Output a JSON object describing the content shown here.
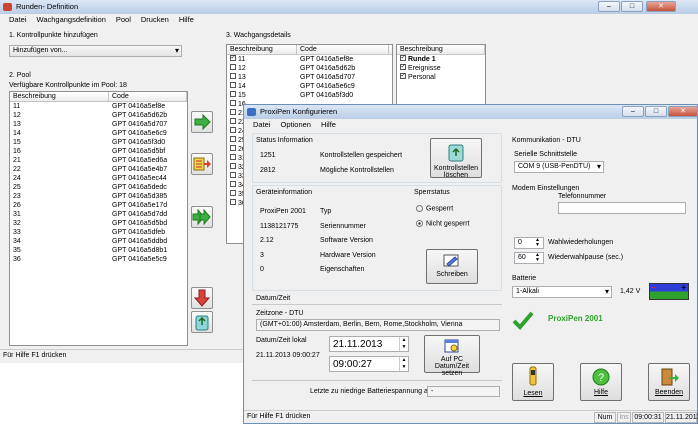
{
  "main": {
    "title": "Runden- Definition",
    "menu": [
      "Datei",
      "Wachgangsdefinition",
      "Pool",
      "Drucken",
      "Hilfe"
    ],
    "step1": "1. Kontrollpunkte hinzufügen",
    "add_dropdown": "Hinzufügen von...",
    "step2": "2. Pool",
    "pool_count": "Verfügbare Kontrollpunkte im Pool: 18",
    "pool_headers": [
      "Beschreibung",
      "Code"
    ],
    "pool_rows": [
      [
        "11",
        "GPT 0416a5ef8e"
      ],
      [
        "12",
        "GPT 0416a5d62b"
      ],
      [
        "13",
        "GPT 0416a5d707"
      ],
      [
        "14",
        "GPT 0416a5e6c9"
      ],
      [
        "15",
        "GPT 0416a5f3d0"
      ],
      [
        "16",
        "GPT 0416a5d5bf"
      ],
      [
        "21",
        "GPT 0416a5ed6a"
      ],
      [
        "22",
        "GPT 0416a5e4b7"
      ],
      [
        "24",
        "GPT 0416a5ec44"
      ],
      [
        "25",
        "GPT 0416a5dedc"
      ],
      [
        "23",
        "GPT 0416a5d385"
      ],
      [
        "26",
        "GPT 0416a5e17d"
      ],
      [
        "31",
        "GPT 0416a5d7dd"
      ],
      [
        "32",
        "GPT 0416a5d5bd"
      ],
      [
        "33",
        "GPT 0416a5dfeb"
      ],
      [
        "34",
        "GPT 0416a5ddbd"
      ],
      [
        "35",
        "GPT 0416a5d8b1"
      ],
      [
        "36",
        "GPT 0416a5e5c9"
      ]
    ],
    "step3": "3. Wachgangsdetails",
    "details_headers": [
      "Beschreibung",
      "Code"
    ],
    "details_rows": [
      [
        "11",
        "GPT 0416a5ef8e"
      ],
      [
        "12",
        "GPT 0416a5d62b"
      ],
      [
        "13",
        "GPT 0416a5d707"
      ],
      [
        "14",
        "GPT 0416a5e6c9"
      ],
      [
        "15",
        "GPT 0416a5f3d0"
      ]
    ],
    "details_more": [
      "16",
      "21",
      "22",
      "24",
      "25",
      "26",
      "31",
      "32",
      "33",
      "34",
      "35",
      "36"
    ],
    "round_header": "Beschreibung",
    "round_items": [
      "Runde 1",
      "Ereignisse",
      "Personal"
    ],
    "status": "Für Hilfe F1 drücken"
  },
  "dialog": {
    "title": "ProxiPen Konfigurieren",
    "menu": [
      "Datei",
      "Optionen",
      "Hilfe"
    ],
    "status_info": "Status Information",
    "stored_value": "1251",
    "stored_label": "Kontrollstellen gespeichert",
    "possible_value": "2812",
    "possible_label": "Mögliche Kontrollstellen",
    "delete_btn": "Kontrollstellen löschen",
    "device_info": "Geräteinformation",
    "type_value": "ProxiPen 2001",
    "type_label": "Typ",
    "serial_value": "1138121775",
    "serial_label": "Seriennummer",
    "sw_value": "2.12",
    "sw_label": "Software Version",
    "hw_value": "3",
    "hw_label": "Hardware Version",
    "props_value": "0",
    "props_label": "Eigenschaften",
    "lock_status": "Sperrstatus",
    "locked": "Gesperrt",
    "unlocked": "Nicht gesperrt",
    "write_btn": "Schreiben",
    "datetime": "Datum/Zeit",
    "timezone_label": "Zeitzone - DTU",
    "timezone_value": "(GMT+01:00) Amsterdam, Berlin, Bern, Rome,Stockholm, Vienna",
    "local_label": "Datum/Zeit lokal",
    "local_value": "21.11.2013 09:00:27",
    "date_input": "21.11.2013",
    "time_input": "09:00:27",
    "set_pc_btn": "Auf PC Datum/Zeit setzen",
    "battery_last": "Letzte zu niedrige Batteriespannung am",
    "battery_last_value": "-",
    "comm": "Kommunikation - DTU",
    "serial_port_label": "Serielle Schnittstelle",
    "serial_port_value": "COM 9 (USB-PenDTU)",
    "modem": "Modem Einstellungen",
    "phone_label": "Telefonnummer",
    "redial_value": "0",
    "redial_label": "Wahlwiederholungen",
    "pause_value": "60",
    "pause_label": "Wiederwahlpause (sec.)",
    "battery_label": "Batterie",
    "battery_type": "1-Alkali",
    "battery_voltage": "1,42 V",
    "device_name": "ProxiPen 2001",
    "read_btn": "Lesen",
    "help_btn": "Hilfe",
    "exit_btn": "Beenden",
    "status": "Für Hilfe F1 drücken",
    "status_num": "Num",
    "status_ins": "Ins",
    "status_time": "09:00:31",
    "status_date": "21.11.2013"
  },
  "colors": {
    "accent_green": "#2ea12e",
    "arrow_green": "#3cb043",
    "arrow_red": "#d9433a"
  }
}
